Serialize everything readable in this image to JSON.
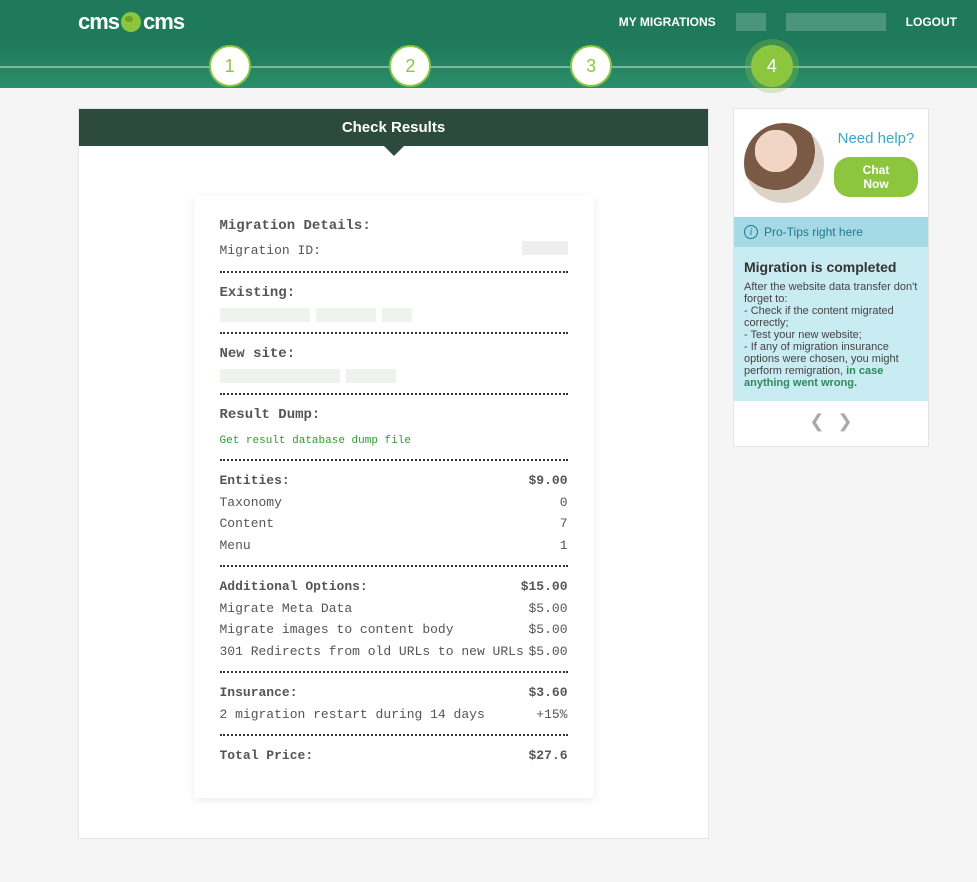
{
  "brand": {
    "left": "cms",
    "right": "cms"
  },
  "nav": {
    "my_migrations": "MY MIGRATIONS",
    "logout": "LOGOUT"
  },
  "steps": [
    "1",
    "2",
    "3",
    "4"
  ],
  "main_title": "Check Results",
  "receipt": {
    "details_h": "Migration Details:",
    "migration_id_lbl": "Migration ID:",
    "existing_h": "Existing:",
    "new_site_h": "New site:",
    "result_dump_h": "Result Dump:",
    "result_dump_link": "Get result database dump file",
    "entities_h": "Entities:",
    "entities_total": "$9.00",
    "entities": [
      {
        "label": "Taxonomy",
        "val": "0"
      },
      {
        "label": "Content",
        "val": "7"
      },
      {
        "label": "Menu",
        "val": "1"
      }
    ],
    "addopts_h": "Additional Options:",
    "addopts_total": "$15.00",
    "addopts": [
      {
        "label": "Migrate Meta Data",
        "val": "$5.00"
      },
      {
        "label": "Migrate images to content body",
        "val": "$5.00"
      },
      {
        "label": "301 Redirects from old URLs to new URLs",
        "val": "$5.00"
      }
    ],
    "insurance_h": "Insurance:",
    "insurance_total": "$3.60",
    "insurance_line": {
      "label": "2 migration restart during 14 days",
      "val": "+15%"
    },
    "total_h": "Total Price:",
    "total_val": "$27.6"
  },
  "sidebar": {
    "need_help": "Need help?",
    "chat_now": "Chat Now",
    "pro_tips": "Pro-Tips right here",
    "tip_title": "Migration is completed",
    "tip_intro": "After the website data transfer don't forget to:",
    "tip_l1": "- Check if the content migrated correctly;",
    "tip_l2": "- Test your new website;",
    "tip_l3a": "- If any of migration insurance options were chosen, you might perform remigration, ",
    "tip_l3b": "in case anything went wrong."
  }
}
